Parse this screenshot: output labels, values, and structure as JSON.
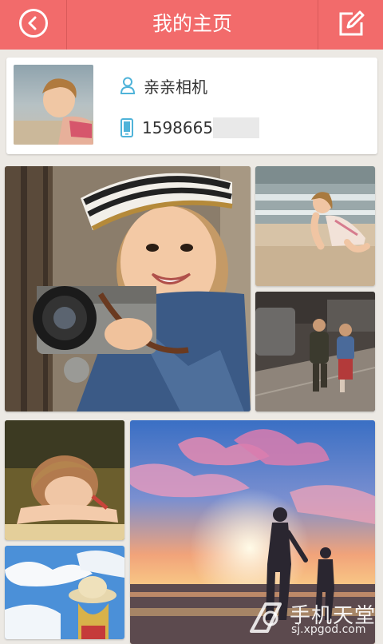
{
  "header": {
    "title": "我的主页",
    "back_icon": "back-arrow-icon",
    "edit_icon": "edit-icon",
    "bar_color": "#f26b6b"
  },
  "profile": {
    "name": "亲亲相机",
    "phone": "1598665",
    "user_icon": "user-icon",
    "phone_icon": "phone-icon",
    "icon_color": "#4fb3d9"
  },
  "gallery": {
    "photos": [
      {
        "subject": "girl-with-camera"
      },
      {
        "subject": "toddler-on-beach"
      },
      {
        "subject": "children-walking-street"
      },
      {
        "subject": "girl-resting-on-arms"
      },
      {
        "subject": "parent-child-sunset"
      },
      {
        "subject": "child-with-straw-hat"
      }
    ]
  },
  "watermark": {
    "name": "手机天堂",
    "url": "sj.xpgod.com"
  }
}
